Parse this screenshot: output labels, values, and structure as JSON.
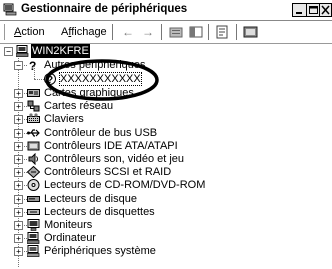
{
  "window": {
    "title": "Gestionnaire de périphériques"
  },
  "menu": {
    "action": "Action",
    "action_u": "A",
    "action_rest": "ction",
    "view": "Affichage",
    "view_u": "f",
    "view_a": "A",
    "view_rest": "fichage"
  },
  "tree": {
    "root": "WIN2KFRE",
    "items": [
      {
        "label": "Autres périphériques",
        "icon": "question-icon",
        "expanded": true
      },
      {
        "label": "XXXXXXXXXXX",
        "icon": "unknown-device-icon",
        "child": true
      },
      {
        "label": "Cartes graphiques",
        "icon": "display-adapter-icon"
      },
      {
        "label": "Cartes réseau",
        "icon": "network-adapter-icon"
      },
      {
        "label": "Claviers",
        "icon": "keyboard-icon"
      },
      {
        "label": "Contrôleur de bus USB",
        "icon": "usb-icon"
      },
      {
        "label": "Contrôleurs IDE ATA/ATAPI",
        "icon": "ide-controller-icon"
      },
      {
        "label": "Contrôleurs son, vidéo et jeu",
        "icon": "sound-icon"
      },
      {
        "label": "Contrôleurs SCSI et RAID",
        "icon": "scsi-icon"
      },
      {
        "label": "Lecteurs de CD-ROM/DVD-ROM",
        "icon": "cdrom-icon"
      },
      {
        "label": "Lecteurs de disque",
        "icon": "disk-drive-icon"
      },
      {
        "label": "Lecteurs de disquettes",
        "icon": "floppy-drive-icon"
      },
      {
        "label": "Moniteurs",
        "icon": "monitor-icon"
      },
      {
        "label": "Ordinateur",
        "icon": "computer-icon"
      },
      {
        "label": "Périphériques système",
        "icon": "system-devices-icon"
      }
    ]
  }
}
